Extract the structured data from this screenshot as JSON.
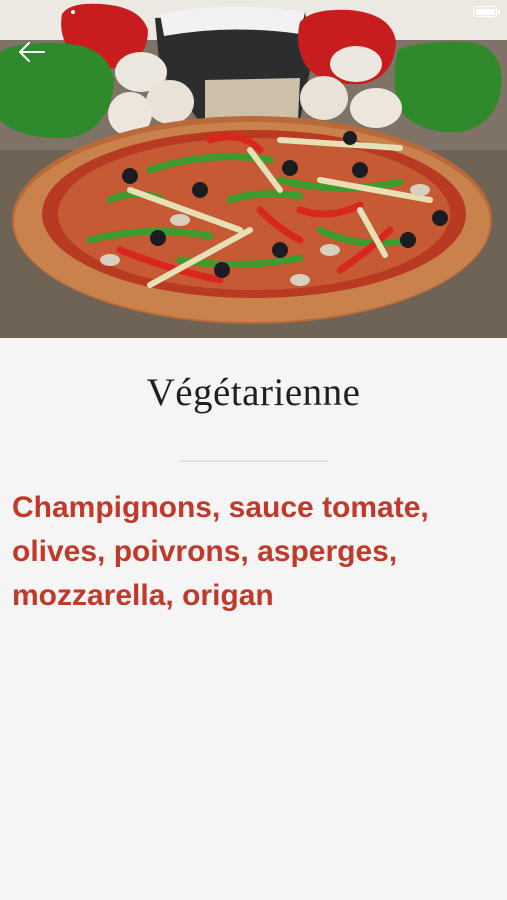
{
  "header": {
    "back_icon": "arrow-left-icon",
    "battery_icon": "battery-icon"
  },
  "pizza": {
    "name": "Végétarienne",
    "ingredients": "Champignons, sauce tomate, olives, poivrons, asperges, mozzarella, origan"
  },
  "colors": {
    "background": "#f5f5f5",
    "title": "#1f1f1f",
    "ingredients": "#c0392b",
    "divider": "#e4e4e4"
  }
}
